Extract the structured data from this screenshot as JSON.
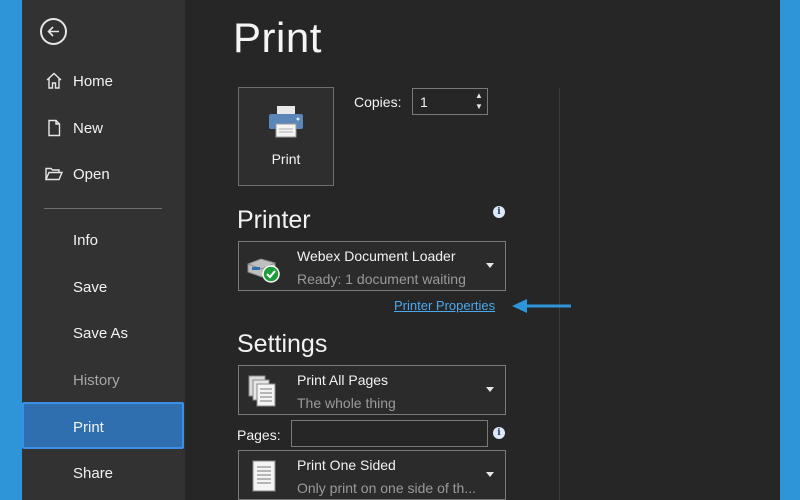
{
  "sidebar": {
    "back_icon": "arrow-left-circle-icon",
    "items": [
      {
        "label": "Home",
        "icon": "home-icon"
      },
      {
        "label": "New",
        "icon": "document-icon"
      },
      {
        "label": "Open",
        "icon": "folder-open-icon"
      },
      {
        "label": "Info"
      },
      {
        "label": "Save"
      },
      {
        "label": "Save As"
      },
      {
        "label": "History"
      },
      {
        "label": "Print"
      },
      {
        "label": "Share"
      }
    ],
    "active": "Print"
  },
  "main": {
    "title": "Print",
    "print_button_label": "Print",
    "copies_label": "Copies:",
    "copies_value": "1",
    "printer": {
      "heading": "Printer",
      "name": "Webex Document Loader",
      "status": "Ready: 1 document waiting",
      "properties_link": "Printer Properties"
    },
    "settings": {
      "heading": "Settings",
      "pages_dropdown": {
        "main": "Print All Pages",
        "sub": "The whole thing"
      },
      "pages_label": "Pages:",
      "pages_value": "",
      "sides_dropdown": {
        "main": "Print One Sided",
        "sub": "Only print on one side of th..."
      }
    }
  },
  "colors": {
    "accent_blue": "#2d95d8",
    "active_nav": "#2f6fb0",
    "link": "#4aa8ef",
    "background": "#262626",
    "sidebar": "#323232"
  }
}
